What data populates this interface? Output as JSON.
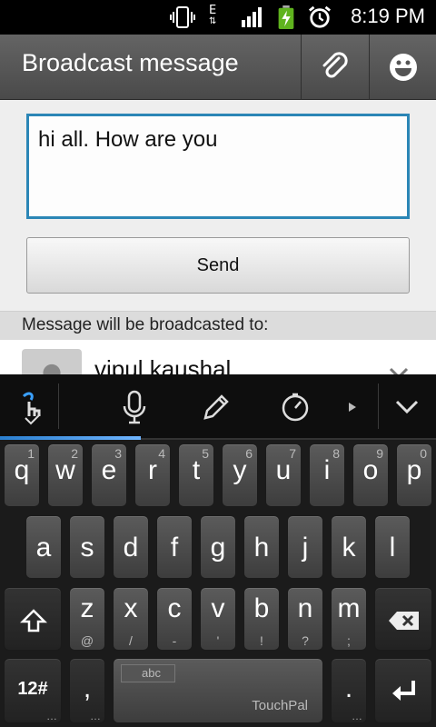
{
  "status_bar": {
    "time": "8:19 PM",
    "network_type": "E",
    "icons": [
      "vibrate-icon",
      "network-e-icon",
      "signal-icon",
      "battery-charging-icon",
      "alarm-icon"
    ]
  },
  "action_bar": {
    "title": "Broadcast message",
    "actions": [
      "attach-icon",
      "emoji-icon"
    ]
  },
  "compose": {
    "message_value": "hi all. How are you",
    "send_label": "Send"
  },
  "broadcast": {
    "header": "Message will be broadcasted to:",
    "recipients": [
      {
        "name": "vipul kaushal"
      }
    ]
  },
  "keyboard": {
    "toolbar_icons": [
      "touchpal-gesture-icon",
      "microphone-icon",
      "pencil-icon",
      "speedometer-icon",
      "arrow-right-icon",
      "collapse-keyboard-icon"
    ],
    "row1": [
      {
        "main": "q",
        "sub": "1"
      },
      {
        "main": "w",
        "sub": "2"
      },
      {
        "main": "e",
        "sub": "3"
      },
      {
        "main": "r",
        "sub": "4"
      },
      {
        "main": "t",
        "sub": "5"
      },
      {
        "main": "y",
        "sub": "6"
      },
      {
        "main": "u",
        "sub": "7"
      },
      {
        "main": "i",
        "sub": "8"
      },
      {
        "main": "o",
        "sub": "9"
      },
      {
        "main": "p",
        "sub": "0"
      }
    ],
    "row2": [
      "a",
      "s",
      "d",
      "f",
      "g",
      "h",
      "j",
      "k",
      "l"
    ],
    "row3": [
      {
        "main": "z",
        "sub": "@"
      },
      {
        "main": "x",
        "sub": "/"
      },
      {
        "main": "c",
        "sub": "-"
      },
      {
        "main": "v",
        "sub": "'"
      },
      {
        "main": "b",
        "sub": "!"
      },
      {
        "main": "n",
        "sub": "?"
      },
      {
        "main": "m",
        "sub": ";"
      }
    ],
    "symbols_label": "12#",
    "comma_label": ",",
    "period_label": ".",
    "space_lang": "abc",
    "space_brand": "TouchPal",
    "accent_color": "#2b86b6"
  }
}
